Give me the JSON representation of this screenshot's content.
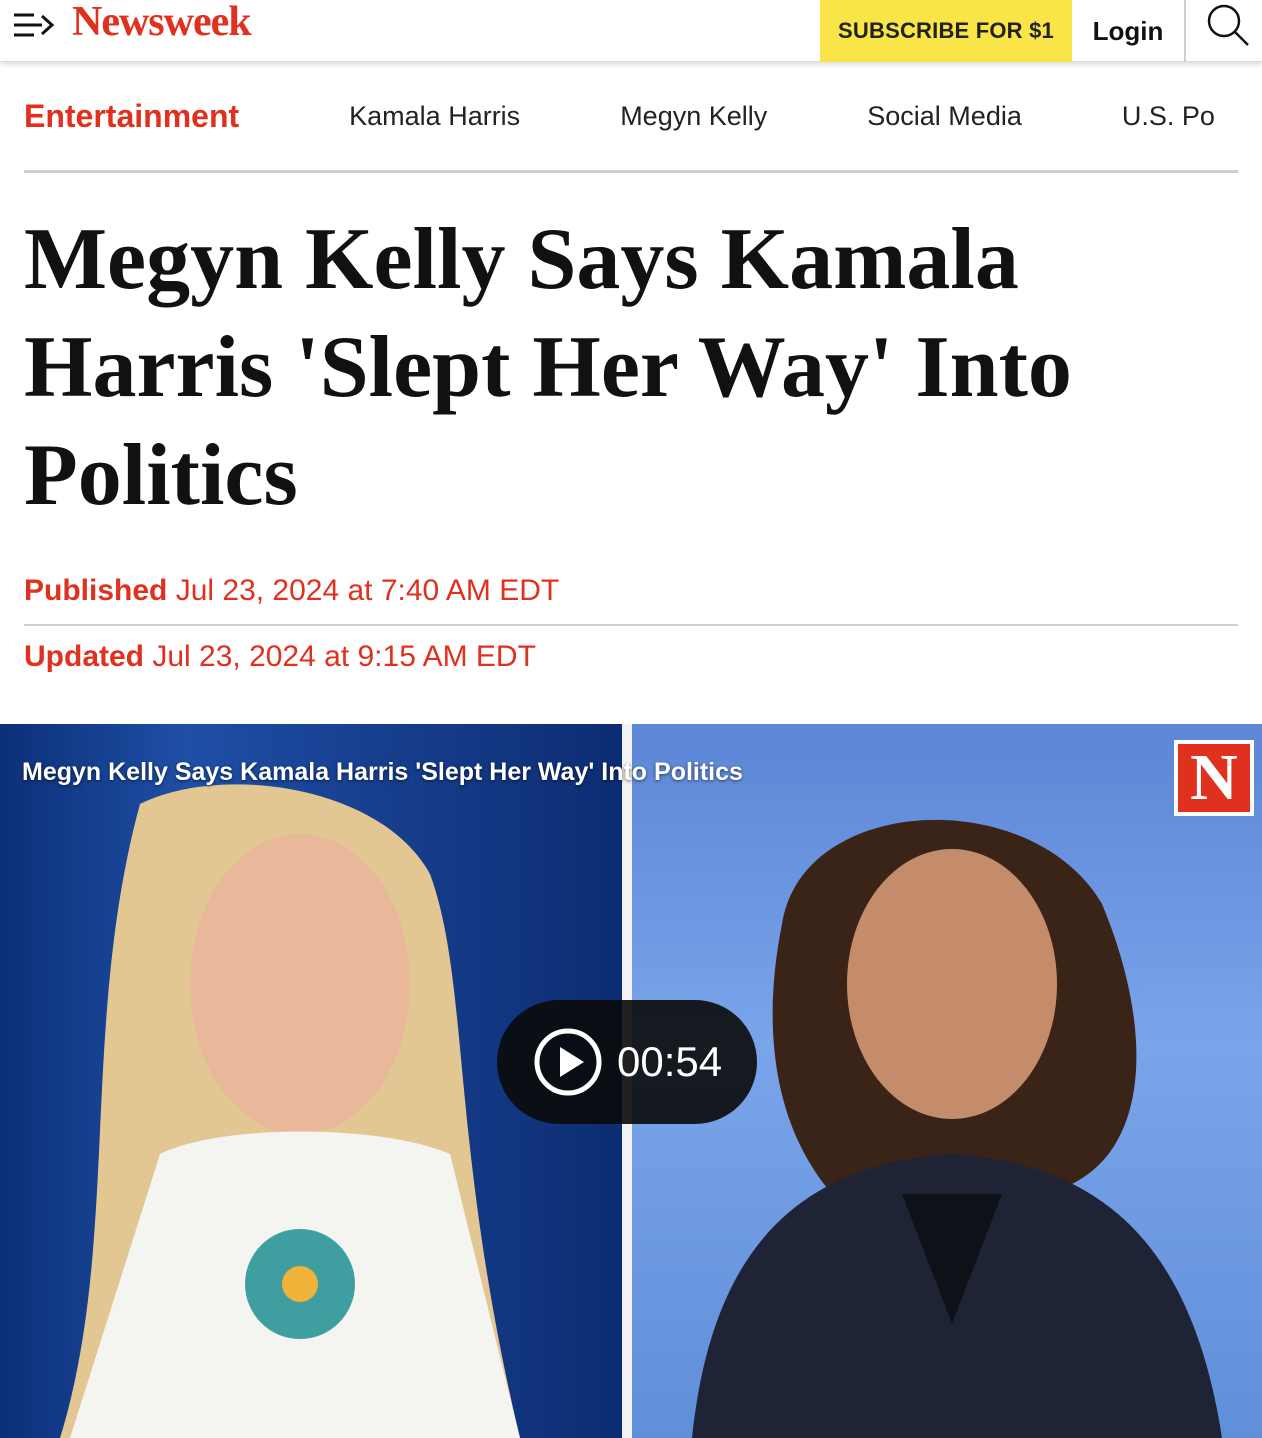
{
  "header": {
    "logo": "Newsweek",
    "subscribe_label": "SUBSCRIBE FOR $1",
    "login_label": "Login",
    "icons": {
      "menu": "menu-arrow-icon",
      "search": "search-icon"
    },
    "colors": {
      "brand_red": "#e0301e",
      "subscribe_yellow": "#f9e547"
    }
  },
  "nav": {
    "section": "Entertainment",
    "topics": [
      "Kamala Harris",
      "Megyn Kelly",
      "Social Media",
      "U.S. Po"
    ]
  },
  "article": {
    "headline": "Megyn Kelly Says Kamala Harris 'Slept Her Way' Into Politics",
    "published_label": "Published",
    "published_value": "Jul 23, 2024 at 7:40 AM EDT",
    "updated_label": "Updated",
    "updated_value": "Jul 23, 2024 at 9:15 AM EDT"
  },
  "video": {
    "title": "Megyn Kelly Says Kamala Harris 'Slept Her Way' Into Politics",
    "badge": "N",
    "duration": "00:54",
    "play_icon": "play-icon"
  }
}
